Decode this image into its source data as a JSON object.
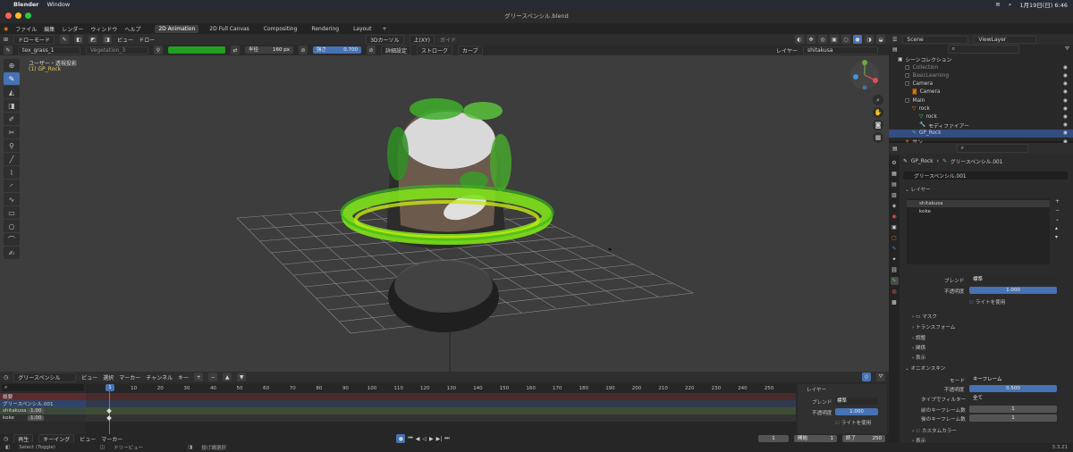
{
  "mac": {
    "apple": "",
    "app": "Blender",
    "menu": "Window",
    "clock": "1月19日(日) 6:46"
  },
  "title": "グリースペンシル.blend",
  "menubar": [
    "ファイル",
    "編集",
    "レンダー",
    "ウィンドウ",
    "ヘルプ"
  ],
  "workspaces": [
    "2D Animation",
    "2D Full Canvas",
    "Compositing",
    "Rendering",
    "Layout"
  ],
  "add_workspace": "+",
  "header": {
    "mode": "ドローモード",
    "menus": [
      "ビュー",
      "ドロー"
    ],
    "orientation": "3Dカーソル",
    "axis": "上(XY)",
    "guide": "ガイド",
    "material_left": "tex_grass_1",
    "material_right": "Vegetation_3",
    "radius_label": "半径",
    "radius_value": "160 px",
    "strength_label": "強さ",
    "strength_value": "0.700",
    "advanced": "詳細設定",
    "stroke": "ストローク",
    "curve": "カーブ",
    "layer_label": "レイヤー",
    "layer_value": "shitakusa",
    "brush_color": "#22a022"
  },
  "viewport": {
    "view_name": "ユーザー・透視投影",
    "object_name": "(1) GP_Rock",
    "bg": "#3d3d3d"
  },
  "outliner": {
    "scene": "Scene",
    "viewlayer": "ViewLayer",
    "items": [
      {
        "label": "シーンコレクション",
        "depth": 0
      },
      {
        "label": "Collection",
        "depth": 1
      },
      {
        "label": "BasicLearning",
        "depth": 1
      },
      {
        "label": "Camera",
        "depth": 1
      },
      {
        "label": "Camera",
        "depth": 2
      },
      {
        "label": "Main",
        "depth": 1
      },
      {
        "label": "rock",
        "depth": 2
      },
      {
        "label": "rock",
        "depth": 3
      },
      {
        "label": "モディファイアー",
        "depth": 3
      },
      {
        "label": "GP_Rock",
        "depth": 2
      },
      {
        "label": "サン",
        "depth": 1
      }
    ]
  },
  "properties": {
    "breadcrumb_obj": "GP_Rock",
    "breadcrumb_data": "グリースペンシル.001",
    "datablock": "グリースペンシル.001",
    "layer_section": "レイヤー",
    "layers": [
      "shitakusa",
      "koke"
    ],
    "blend_label": "ブレンド",
    "blend_value": "標準",
    "opacity_label": "不透明度",
    "opacity_value": "1.000",
    "use_lights": "ライトを使用",
    "sub_sections": [
      "マスク",
      "トランスフォーム",
      "調整",
      "関係",
      "表示"
    ],
    "onion_section": "オニオンスキン",
    "mode_label": "モード",
    "mode_value": "キーフレーム",
    "onion_opacity_label": "不透明度",
    "onion_opacity_value": "0.500",
    "filter_label": "タイプでフィルター",
    "filter_value": "全て",
    "before_label": "前のキーフレーム数",
    "before_value": "1",
    "after_label": "後のキーフレーム数",
    "after_value": "1",
    "custom_color": "カスタムカラー",
    "display": "表示"
  },
  "timeline": {
    "editor": "グリースペンシル",
    "menus": [
      "ビュー",
      "選択",
      "マーカー",
      "チャンネル",
      "キー"
    ],
    "frame_current": "1",
    "ticks": [
      "10",
      "20",
      "30",
      "40",
      "50",
      "60",
      "70",
      "80",
      "90",
      "100",
      "110",
      "120",
      "130",
      "140",
      "150",
      "160",
      "170",
      "180",
      "190",
      "200",
      "210",
      "220",
      "230",
      "240",
      "250"
    ],
    "summary": "概要",
    "gp_object": "グリースペンシル.001",
    "layers": [
      {
        "name": "shitakusa",
        "value": "1.00"
      },
      {
        "name": "koke",
        "value": "1.00"
      }
    ],
    "panel_title": "レイヤー",
    "blend_label": "ブレンド",
    "blend_value": "標準",
    "opacity_label": "不透明度",
    "opacity_value": "1.000",
    "use_lights": "ライトを使用"
  },
  "playback": {
    "play": "再生",
    "keying": "キーイング",
    "view": "ビュー",
    "marker": "マーカー",
    "current": "1",
    "start_label": "開始",
    "start": "1",
    "end_label": "終了",
    "end": "250"
  },
  "status": {
    "select": "Select (Toggle)",
    "pan": "ドリービュー",
    "context": "投げ縄選択",
    "version": "3.3.21"
  }
}
